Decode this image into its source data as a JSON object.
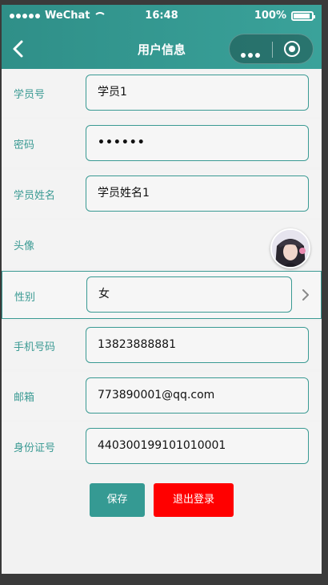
{
  "status": {
    "carrier": "WeChat",
    "time": "16:48",
    "battery": "100%"
  },
  "nav": {
    "title": "用户信息",
    "back_icon": "chevron-left-icon",
    "more_icon": "more-dots-icon",
    "close_icon": "target-close-icon"
  },
  "form": {
    "student_id": {
      "label": "学员号",
      "value": "学员1"
    },
    "password": {
      "label": "密码",
      "value": "••••••"
    },
    "student_name": {
      "label": "学员姓名",
      "value": "学员姓名1"
    },
    "avatar": {
      "label": "头像"
    },
    "gender": {
      "label": "性别",
      "value": "女"
    },
    "phone": {
      "label": "手机号码",
      "value": "13823888881"
    },
    "email": {
      "label": "邮箱",
      "value": "773890001@qq.com"
    },
    "id_card": {
      "label": "身份证号",
      "value": "440300199101010001"
    }
  },
  "actions": {
    "save_label": "保存",
    "logout_label": "退出登录"
  },
  "colors": {
    "accent": "#359a93",
    "danger": "#ff0000"
  }
}
